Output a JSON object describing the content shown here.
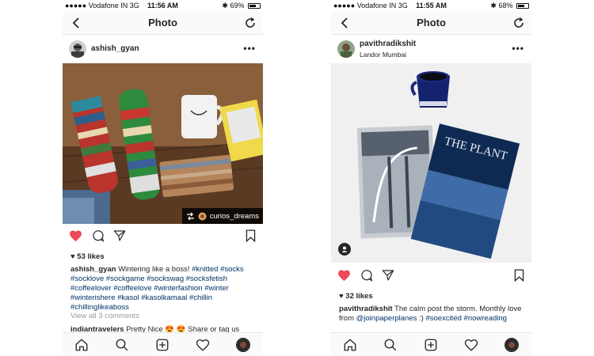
{
  "left": {
    "status": {
      "carrier": "Vodafone IN",
      "network": "3G",
      "time": "11:56 AM",
      "battery_text": "69%",
      "battery_level": 0.69
    },
    "nav": {
      "title": "Photo"
    },
    "post": {
      "username": "ashish_gyan",
      "repost_credit": "curios_dreams",
      "likes": "53 likes",
      "caption_user": "ashish_gyan",
      "caption_text": "Wintering like a boss!",
      "hashtags": [
        "#knitted",
        "#socks",
        "#socklove",
        "#sockgame",
        "#sockswag",
        "#socksfetish",
        "#coffeelover",
        "#coffeelove",
        "#winterfashion",
        "#winter",
        "#winterishere",
        "#kasol",
        "#kasolkamaal",
        "#chillin",
        "#chillinglikeaboss"
      ],
      "view_comments": "View all 3 comments",
      "comment_user": "indiantravelers",
      "comment_text": "Pretty Nice 😍 😍 Share or tag us"
    }
  },
  "right": {
    "status": {
      "carrier": "Vodafone IN",
      "network": "3G",
      "time": "11:55 AM",
      "battery_text": "68%",
      "battery_level": 0.68
    },
    "nav": {
      "title": "Photo"
    },
    "post": {
      "username": "pavithradikshit",
      "location": "Landor Mumbai",
      "magazine_title": "THE PLANT",
      "likes": "32 likes",
      "caption_user": "pavithradikshit",
      "caption_text": "The calm post the storm. Monthly love from",
      "mention": "@joinpaperplanes",
      "caption_tail": ":)",
      "hashtags": [
        "#soexcited",
        "#nowreading"
      ]
    }
  },
  "colors": {
    "like_red": "#ed4956",
    "hashtag_blue": "#003569",
    "muted_gray": "#999999"
  },
  "icons": [
    "back-arrow-icon",
    "refresh-icon",
    "heart-icon",
    "comment-icon",
    "share-icon",
    "bookmark-icon",
    "home-icon",
    "search-icon",
    "add-post-icon",
    "activity-heart-icon",
    "repost-icon",
    "user-tag-icon"
  ]
}
